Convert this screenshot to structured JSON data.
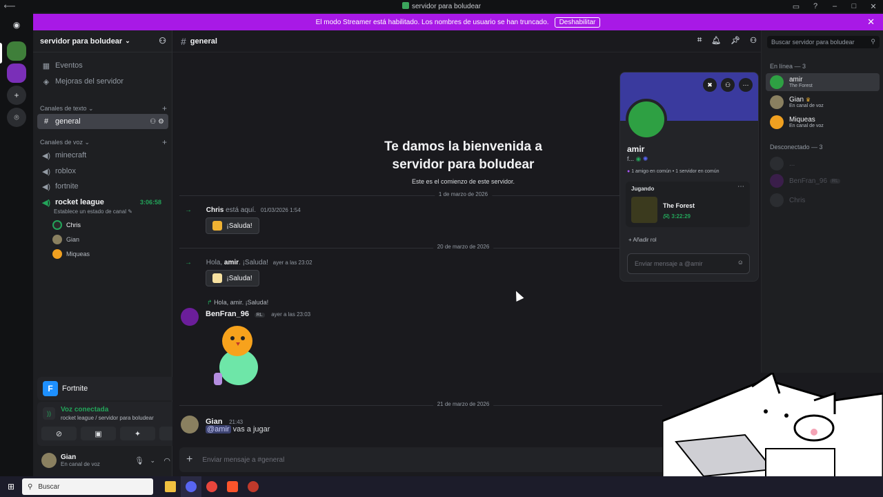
{
  "window": {
    "title": "servidor para boludear"
  },
  "banner": {
    "text": "El modo Streamer está habilitado. Los nombres de usuario se han truncado.",
    "button": "Deshabilitar"
  },
  "server": {
    "name": "servidor para boludear",
    "top_items": [
      "Eventos",
      "Mejoras del servidor"
    ],
    "text_category": "Canales de texto",
    "text_channels": [
      "general"
    ],
    "voice_category": "Canales de voz",
    "voice_channels": [
      "minecraft",
      "roblox",
      "fortnite",
      "rocket league"
    ],
    "rocket_status": "Establece un estado de canal",
    "rocket_timer": "3:06:58",
    "voice_users": [
      "Chris",
      "Gian",
      "Miqueas"
    ]
  },
  "panels": {
    "game": "Fortnite",
    "voice_connected": "Voz conectada",
    "voice_location": "rocket league / servidor para boludear",
    "user_name": "Gian",
    "user_status": "En canal de voz"
  },
  "chat": {
    "channel": "general",
    "welcome_line1": "Te damos la bienvenida a",
    "welcome_line2": "servidor para boludear",
    "welcome_sub": "Este es el comienzo de este servidor.",
    "date1": "1 de marzo de 2026",
    "sys1_name": "Chris",
    "sys1_text": "está aquí.",
    "sys1_ts": "01/03/2026 1:54",
    "wave": "¡Saluda!",
    "date2": "20 de marzo de 2026",
    "sys2_pre": "Hola,",
    "sys2_name": "amir",
    "sys2_text": ". ¡Saluda!",
    "sys2_ts": "ayer a las 23:02",
    "reply_text": "Hola, amir. ¡Saluda!",
    "msg3_author": "BenFran_96",
    "msg3_tag": "RL",
    "msg3_ts": "ayer a las 23:03",
    "date3": "21 de marzo de 2026",
    "msg4_author": "Gian",
    "msg4_ts": "21:43",
    "msg4_mention": "@amir",
    "msg4_text": "vas a jugar",
    "composer_placeholder": "Enviar mensaje a #general"
  },
  "members": {
    "search_placeholder": "Buscar servidor para boludear",
    "online_label": "En línea — 3",
    "online": [
      {
        "name": "amir",
        "status": "The Forest"
      },
      {
        "name": "Gian",
        "status": "En canal de voz"
      },
      {
        "name": "Miqueas",
        "status": "En canal de voz"
      }
    ],
    "offline_label": "Desconectado — 3",
    "offline": [
      "...",
      "BenFran_96",
      "Chris"
    ],
    "offline_tag": "RL"
  },
  "popout": {
    "name": "amir",
    "sub": "f...",
    "mutual": "1 amigo en común • 1 servidor en común",
    "activity_label": "Jugando",
    "game_name": "The Forest",
    "game_time": "3:22:29",
    "add_role": "Añadir rol",
    "message_placeholder": "Enviar mensaje a @amir"
  },
  "taskbar": {
    "search_placeholder": "Buscar"
  },
  "colors": {
    "accent": "#a819e6",
    "online": "#23a55a",
    "blurple": "#5865f2"
  }
}
